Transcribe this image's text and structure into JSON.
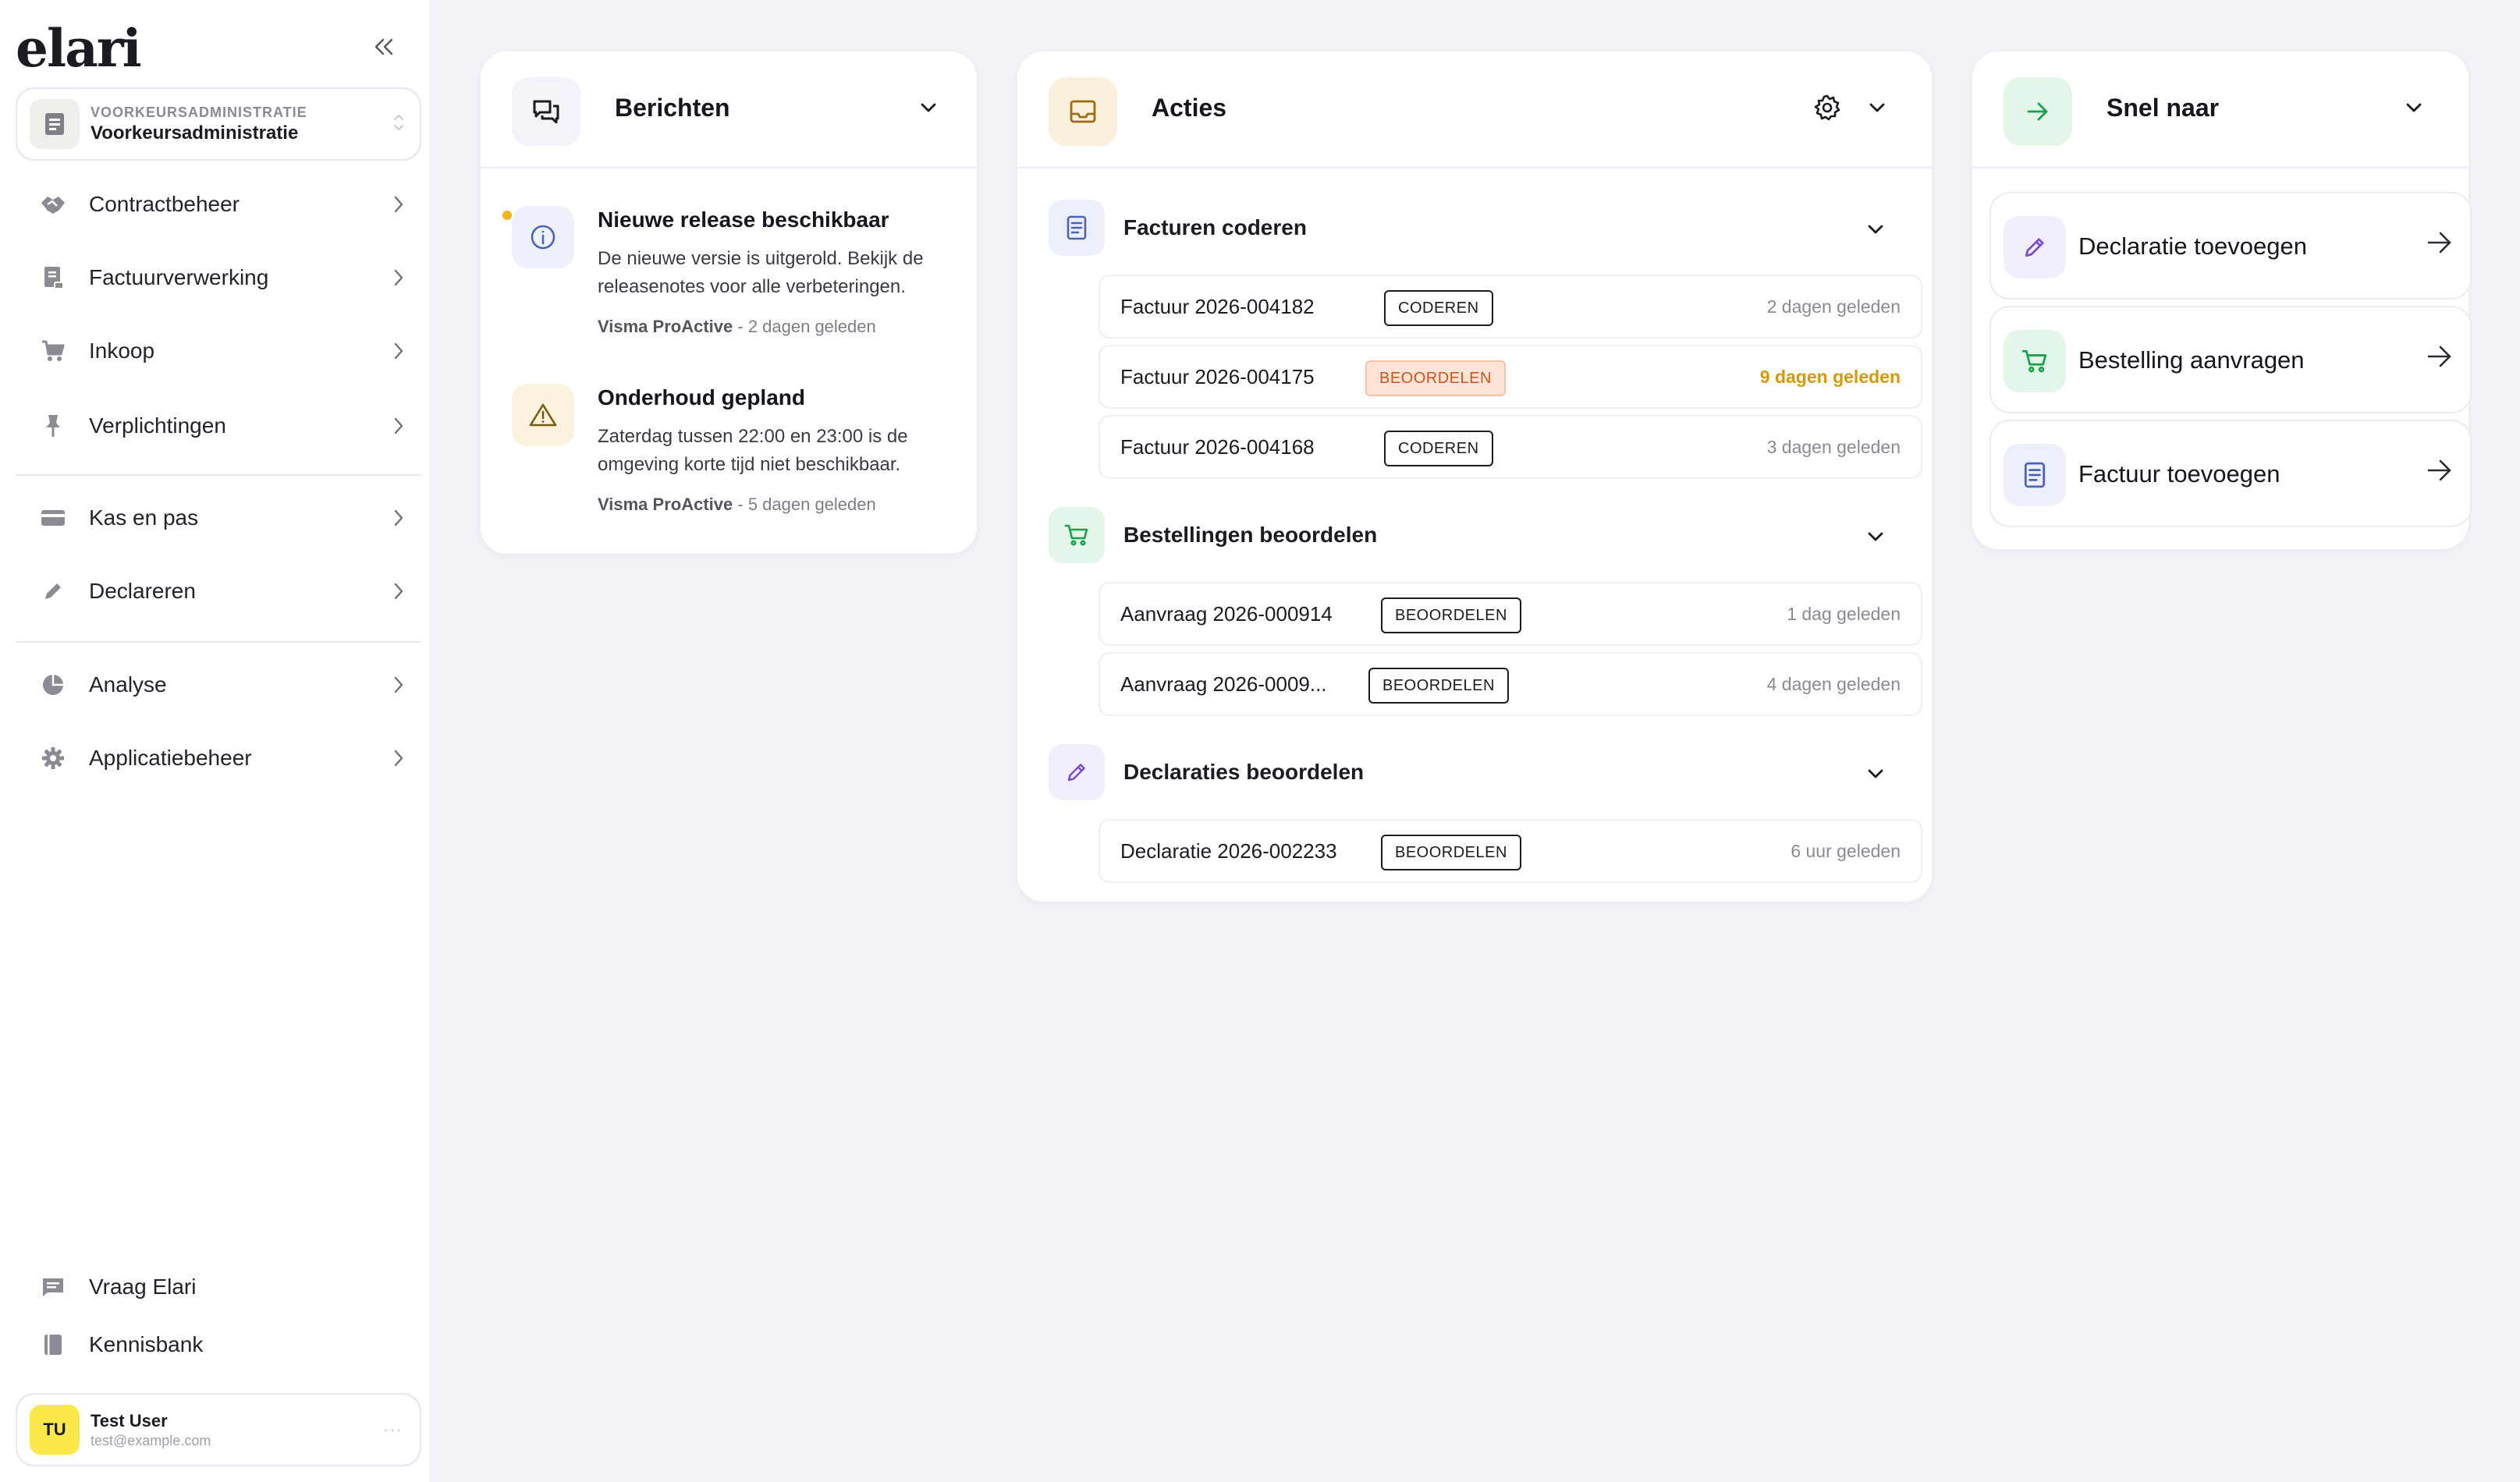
{
  "app": {
    "logo": "elari"
  },
  "org": {
    "caption": "VOORKEURSADMINISTRATIE",
    "name": "Voorkeursadministratie"
  },
  "sidebar": {
    "items": [
      {
        "label": "Contractbeheer",
        "icon": "handshake-icon"
      },
      {
        "label": "Factuurverwerking",
        "icon": "receipt-icon"
      },
      {
        "label": "Inkoop",
        "icon": "cart-icon"
      },
      {
        "label": "Verplichtingen",
        "icon": "pin-icon"
      },
      {
        "label": "Kas en pas",
        "icon": "card-icon"
      },
      {
        "label": "Declareren",
        "icon": "pencil-icon"
      },
      {
        "label": "Analyse",
        "icon": "pie-icon"
      },
      {
        "label": "Applicatiebeheer",
        "icon": "gear-icon"
      }
    ],
    "bottom": [
      {
        "label": "Vraag Elari",
        "icon": "chat-icon"
      },
      {
        "label": "Kennisbank",
        "icon": "book-icon"
      }
    ]
  },
  "user": {
    "initials": "TU",
    "name": "Test User",
    "email": "test@example.com",
    "more": "···"
  },
  "messages": {
    "title": "Berichten",
    "items": [
      {
        "title": "Nieuwe release beschikbaar",
        "body": "De nieuwe versie is uitgerold. Bekijk de releasenotes voor alle verbeteringen.",
        "source": "Visma ProActive",
        "time": "- 2 dagen geleden",
        "icon": "info-icon",
        "unread": true
      },
      {
        "title": "Onderhoud gepland",
        "body": "Zaterdag tussen 22:00 en 23:00 is de omgeving korte tijd niet beschikbaar.",
        "source": "Visma ProActive",
        "time": "- 5 dagen geleden",
        "icon": "warning-icon",
        "unread": false
      }
    ]
  },
  "actions": {
    "title": "Acties",
    "groups": [
      {
        "title": "Facturen coderen",
        "icon": "document-icon",
        "rows": [
          {
            "title": "Factuur 2026-004182",
            "badge": "CODEREN",
            "badge_style": "outline",
            "time": "2 dagen geleden",
            "warn": false
          },
          {
            "title": "Factuur 2026-004175",
            "badge": "BEOORDELEN",
            "badge_style": "orange",
            "time": "9 dagen geleden",
            "warn": true
          },
          {
            "title": "Factuur 2026-004168",
            "badge": "CODEREN",
            "badge_style": "outline",
            "time": "3 dagen geleden",
            "warn": false
          }
        ]
      },
      {
        "title": "Bestellingen beoordelen",
        "icon": "cart-icon",
        "rows": [
          {
            "title": "Aanvraag 2026-000914",
            "badge": "BEOORDELEN",
            "badge_style": "outline",
            "time": "1 dag geleden",
            "warn": false
          },
          {
            "title": "Aanvraag 2026-0009...",
            "badge": "BEOORDELEN",
            "badge_style": "outline",
            "time": "4 dagen geleden",
            "warn": false
          }
        ]
      },
      {
        "title": "Declaraties beoordelen",
        "icon": "pencil-icon",
        "rows": [
          {
            "title": "Declaratie 2026-002233",
            "badge": "BEOORDELEN",
            "badge_style": "outline",
            "time": "6 uur geleden",
            "warn": false
          }
        ]
      }
    ]
  },
  "quick": {
    "title": "Snel naar",
    "items": [
      {
        "label": "Declaratie toevoegen",
        "icon": "pencil-icon"
      },
      {
        "label": "Bestelling aanvragen",
        "icon": "cart-icon"
      },
      {
        "label": "Factuur toevoegen",
        "icon": "document-icon"
      }
    ]
  },
  "colors": {
    "background": "#f3f2f8",
    "warning_text": "#d59a04",
    "orange_badge": "#d1521c",
    "user_avatar": "#fbe94c",
    "green_accent": "#18a34a",
    "purple_accent": "#7b4fd0",
    "blue_accent": "#4b63b8"
  }
}
